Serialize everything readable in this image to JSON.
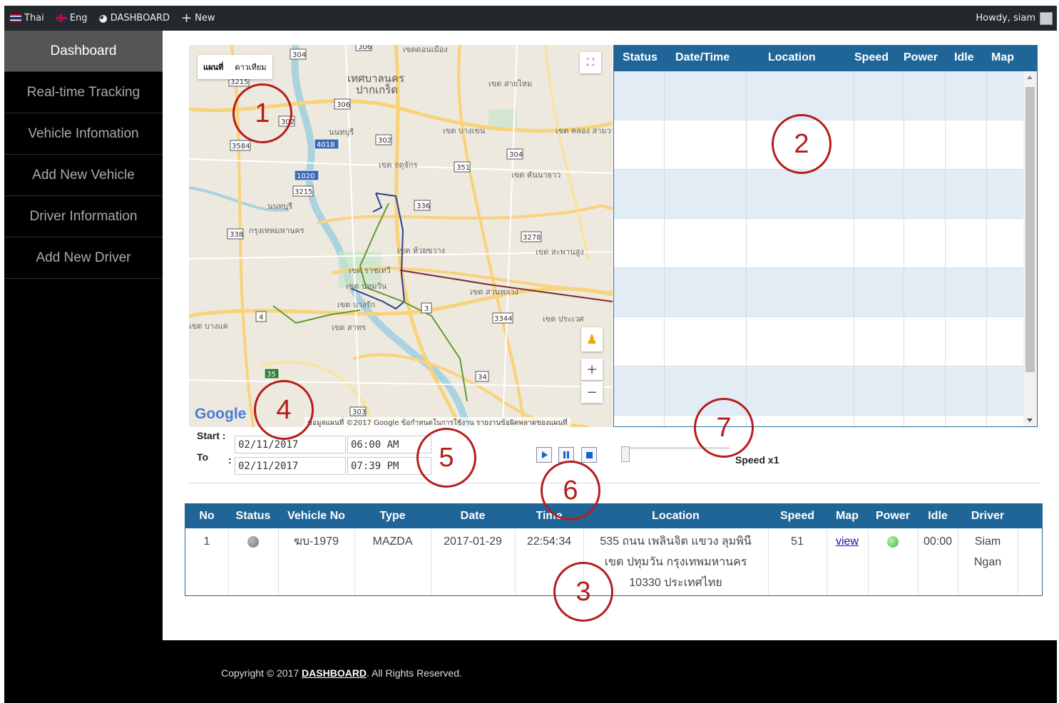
{
  "topbar": {
    "lang_thai": "Thai",
    "lang_eng": "Eng",
    "dashboard_label": "DASHBOARD",
    "new_label": "New",
    "howdy": "Howdy, siam"
  },
  "sidebar": {
    "items": [
      {
        "label": "Dashboard",
        "active": true
      },
      {
        "label": "Real-time Tracking"
      },
      {
        "label": "Vehicle Infomation"
      },
      {
        "label": "Add New Vehicle"
      },
      {
        "label": "Driver Information"
      },
      {
        "label": "Add New Driver"
      }
    ]
  },
  "map": {
    "type_map": "แผนที่",
    "type_satellite": "ดาวเทียม",
    "google": "Google",
    "attribution": "ข้อมูลแผนที่ ©2017 Google   ข้อกำหนดในการใช้งาน   รายงานข้อผิดพลาดของแผนที่",
    "labels": [
      "เขตดอนเมือง",
      "เทศบาลนคร",
      "ปากเกร็ด",
      "เขต สายไหม",
      "นนทบุรี",
      "เขต บางเขน",
      "เขต คลอง สามวา",
      "เขต จตุจักร",
      "เขต คันนายาว",
      "นนทบุรี",
      "กรุงเทพมหานคร",
      "เขต ห้วยขวาง",
      "เขต สะพานสูง",
      "เขต ราชเทวี",
      "เขต ปทุมวัน",
      "เขต สวนหลวง",
      "เขต บางรัก",
      "เขต ประเวศ",
      "เขต บางแค",
      "เขต สาทร"
    ],
    "road_numbers": [
      "304",
      "306",
      "3215",
      "306",
      "302",
      "302",
      "4018",
      "3584",
      "304",
      "351",
      "1020",
      "3215",
      "336",
      "338",
      "3278",
      "3",
      "4",
      "3344",
      "35",
      "34",
      "303"
    ]
  },
  "history_panel": {
    "columns": [
      "Status",
      "Date/Time",
      "Location",
      "Speed",
      "Power",
      "Idle",
      "Map"
    ]
  },
  "controls": {
    "start_label": "Start :",
    "to_label": "To",
    "colon": ":",
    "start_date": "02/11/2017",
    "start_time": "06:00 AM",
    "end_date": "02/11/2017",
    "end_time": "07:39 PM",
    "speed_label": "Speed x1"
  },
  "vehicle_table": {
    "columns": [
      "No",
      "Status",
      "Vehicle No",
      "Type",
      "Date",
      "Time",
      "Location",
      "Speed",
      "Map",
      "Power",
      "Idle",
      "Driver"
    ],
    "rows": [
      {
        "no": "1",
        "vehicle_no": "ฆบ-1979",
        "type": "MAZDA",
        "date": "2017-01-29",
        "time": "22:54:34",
        "location_1": "535 ถนน เพลินจิต แขวง ลุมพินี",
        "location_2": "เขต ปทุมวัน กรุงเทพมหานคร",
        "location_3": "10330 ประเทศไทย",
        "speed": "51",
        "map_link": "view",
        "idle": "00:00",
        "driver_1": "Siam",
        "driver_2": "Ngan"
      }
    ]
  },
  "footer": {
    "prefix": "Copyright © 2017 ",
    "link": "DASHBOARD",
    "suffix": ". All Rights Reserved."
  },
  "annotations": [
    "1",
    "2",
    "3",
    "4",
    "5",
    "6",
    "7"
  ],
  "colors": {
    "header_blue": "#1f6597",
    "row_alt": "#e1ecf4",
    "annotation_red": "#b71c1c",
    "status_offline": "#888888",
    "power_on": "#5cd65c"
  }
}
